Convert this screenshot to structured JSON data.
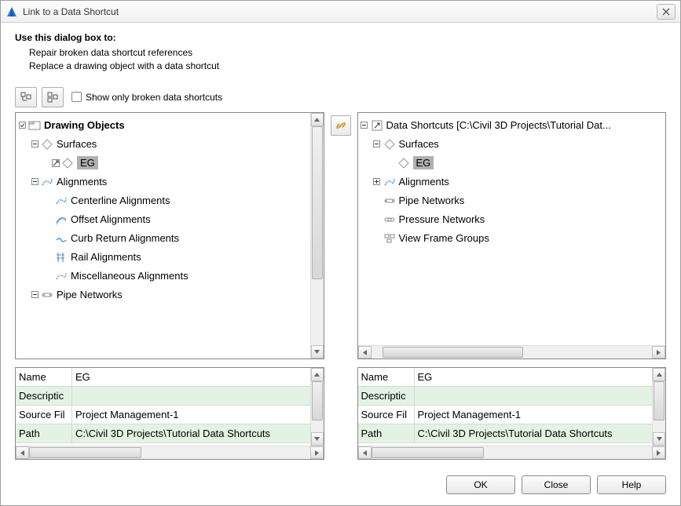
{
  "title": "Link to a Data Shortcut",
  "instructions": {
    "header": "Use this dialog box to:",
    "line1": "Repair broken data shortcut references",
    "line2": "Replace a drawing object with a data shortcut"
  },
  "toolbar": {
    "show_broken_label": "Show only broken data shortcuts"
  },
  "left_tree": {
    "root": "Drawing Objects",
    "nodes": {
      "surfaces": "Surfaces",
      "eg": "EG",
      "alignments": "Alignments",
      "centerline": "Centerline Alignments",
      "offset": "Offset Alignments",
      "curb": "Curb Return Alignments",
      "rail": "Rail Alignments",
      "misc": "Miscellaneous Alignments",
      "pipe": "Pipe Networks"
    }
  },
  "right_tree": {
    "root": "Data Shortcuts [C:\\Civil 3D Projects\\Tutorial Dat...",
    "nodes": {
      "surfaces": "Surfaces",
      "eg": "EG",
      "alignments": "Alignments",
      "pipe": "Pipe Networks",
      "pressure": "Pressure Networks",
      "vfg": "View Frame Groups"
    }
  },
  "left_grid": {
    "rows": {
      "name_l": "Name",
      "name_v": "EG",
      "desc_l": "Descriptic",
      "desc_v": "",
      "src_l": "Source Fil",
      "src_v": "Project Management-1",
      "path_l": "Path",
      "path_v": "C:\\Civil 3D Projects\\Tutorial Data Shortcuts"
    }
  },
  "right_grid": {
    "rows": {
      "name_l": "Name",
      "name_v": "EG",
      "desc_l": "Descriptic",
      "desc_v": "",
      "src_l": "Source Fil",
      "src_v": "Project Management-1",
      "path_l": "Path",
      "path_v": "C:\\Civil 3D Projects\\Tutorial Data Shortcuts"
    }
  },
  "buttons": {
    "ok": "OK",
    "close": "Close",
    "help": "Help"
  }
}
